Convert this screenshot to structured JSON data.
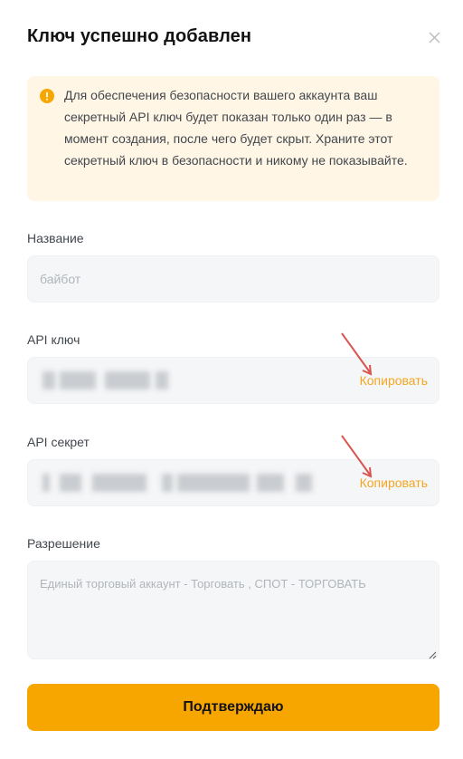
{
  "modal": {
    "title": "Ключ успешно добавлен",
    "warning": "Для обеспечения безопасности вашего аккаунта ваш секретный API ключ будет показан только один раз — в момент создания, после чего будет скрыт. Храните этот секретный ключ в безопасности и никому не показывайте."
  },
  "fields": {
    "name_label": "Название",
    "name_value": "байбот",
    "api_key_label": "API ключ",
    "api_secret_label": "API секрет",
    "copy_label": "Копировать",
    "permission_label": "Разрешение",
    "permission_value": "Единый торговый аккаунт - Торговать  , СПОТ - ТОРГОВАТЬ"
  },
  "confirm_label": "Подтверждаю",
  "colors": {
    "accent": "#f7a600",
    "copy_link": "#f5a623",
    "warning_bg": "#fff6e6",
    "arrow": "#d9534f"
  }
}
